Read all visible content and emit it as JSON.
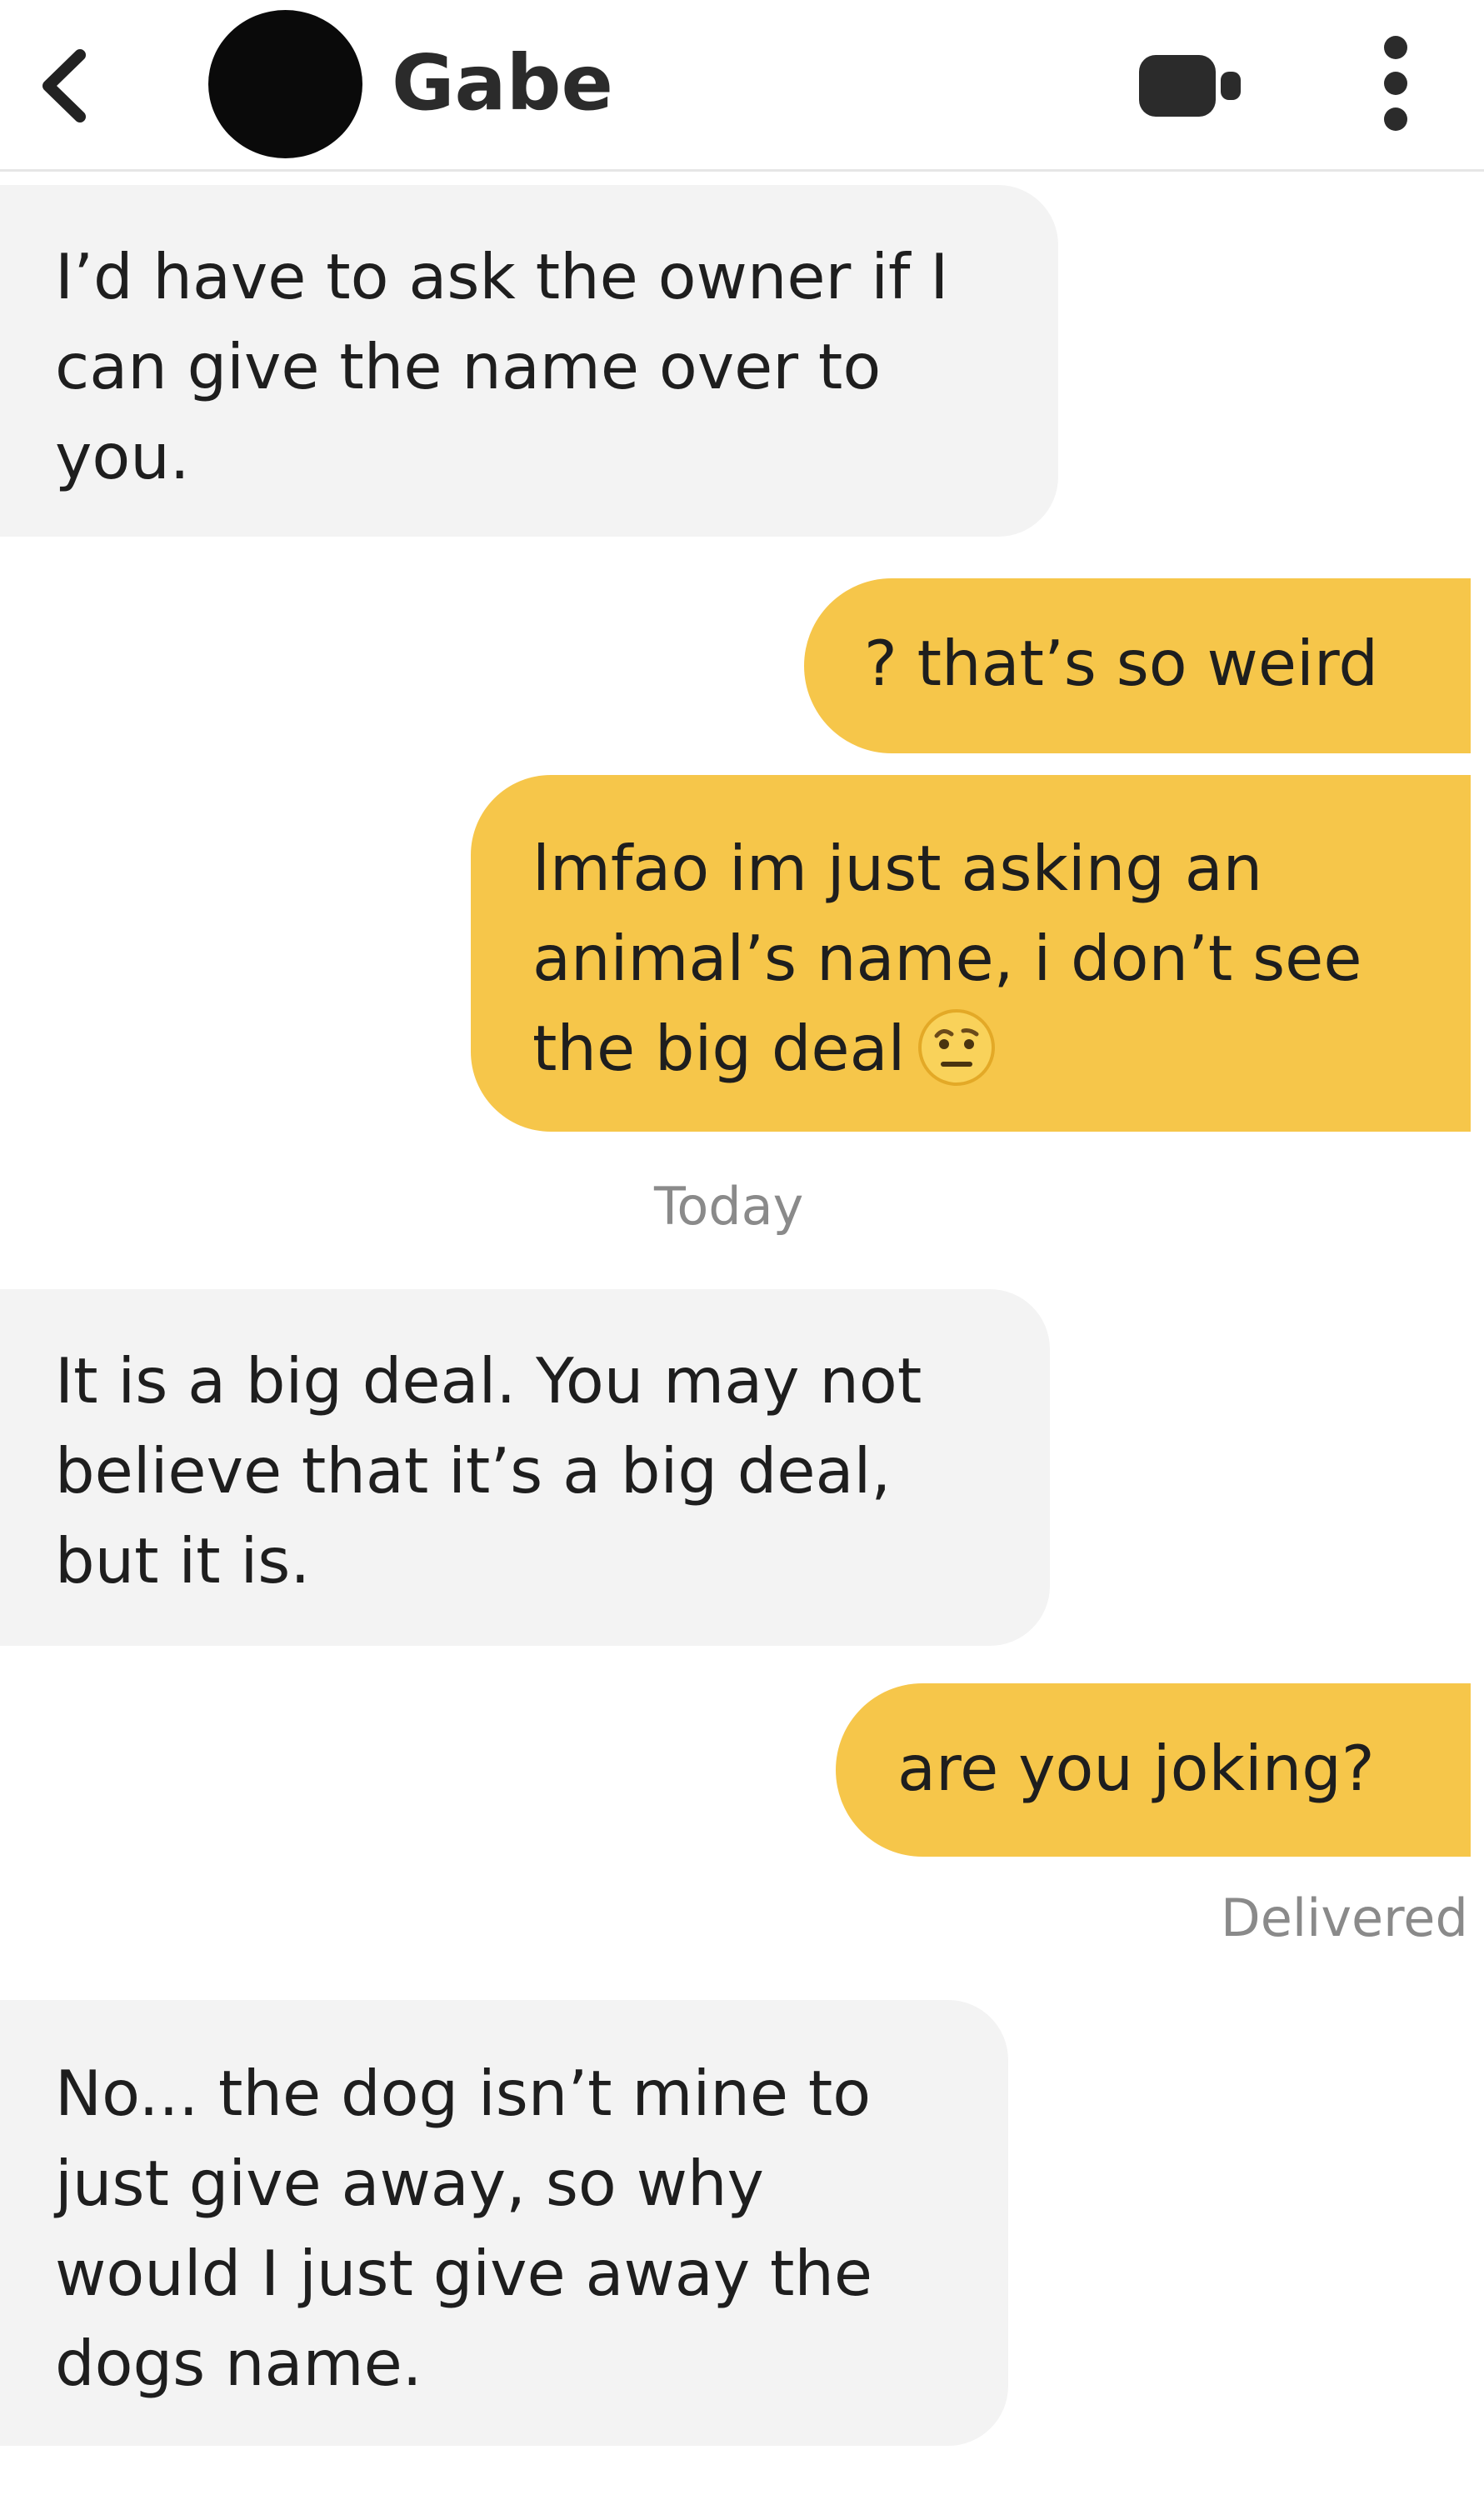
{
  "header": {
    "contact_name": "Gabe",
    "icons": {
      "back": "chevron-left-icon",
      "video": "video-camera-icon",
      "more": "more-vertical-icon"
    }
  },
  "messages": [
    {
      "direction": "incoming",
      "text": "I’d have to ask the owner if I\ncan give the name over to\nyou."
    },
    {
      "direction": "outgoing",
      "text": "? that’s so weird"
    },
    {
      "direction": "outgoing",
      "text": "lmfao im just asking an\nanimal’s name, i don’t see\nthe big deal",
      "emoji": "face-with-raised-eyebrow-emoji"
    },
    {
      "direction": "incoming",
      "text": "It is a big deal. You may not\nbelieve that it’s a big deal,\nbut it is."
    },
    {
      "direction": "outgoing",
      "text": "are you joking?"
    },
    {
      "direction": "incoming",
      "text": "No... the dog isn’t mine to\njust give away, so why\nwould I just give away the\ndogs name."
    }
  ],
  "date_separator": "Today",
  "delivery_status": "Delivered",
  "colors": {
    "outgoing_bubble": "#f6c64a",
    "incoming_bubble": "#f3f3f3",
    "timestamp_text": "#8a8a8a",
    "divider": "#e6e6e6"
  }
}
